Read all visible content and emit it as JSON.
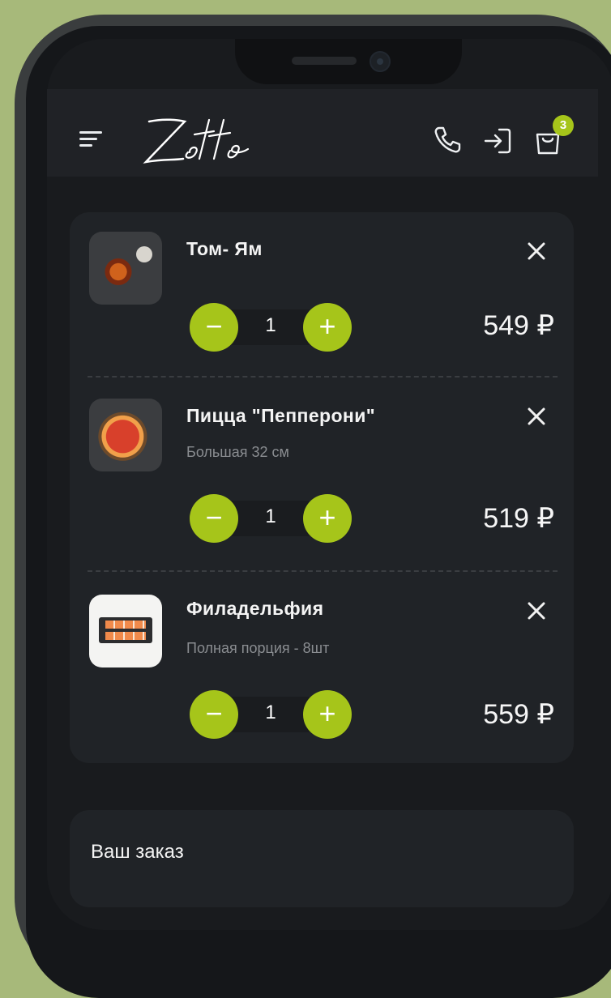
{
  "header": {
    "logo_text": "Zotto",
    "cart_count": "3",
    "icons": [
      "menu-icon",
      "phone-icon",
      "login-icon",
      "shopping-bag-icon"
    ]
  },
  "cart": {
    "items": [
      {
        "title": "Том- Ям",
        "subtitle": "",
        "quantity": "1",
        "price": "549 ₽"
      },
      {
        "title": "Пицца \"Пепперони\"",
        "subtitle": "Большая 32 см",
        "quantity": "1",
        "price": "519 ₽"
      },
      {
        "title": "Филадельфия",
        "subtitle": "Полная порция - 8шт",
        "quantity": "1",
        "price": "559 ₽"
      }
    ]
  },
  "summary": {
    "title": "Ваш заказ"
  },
  "colors": {
    "accent": "#a6c51a",
    "background": "#a7b97a",
    "card": "#202327"
  }
}
